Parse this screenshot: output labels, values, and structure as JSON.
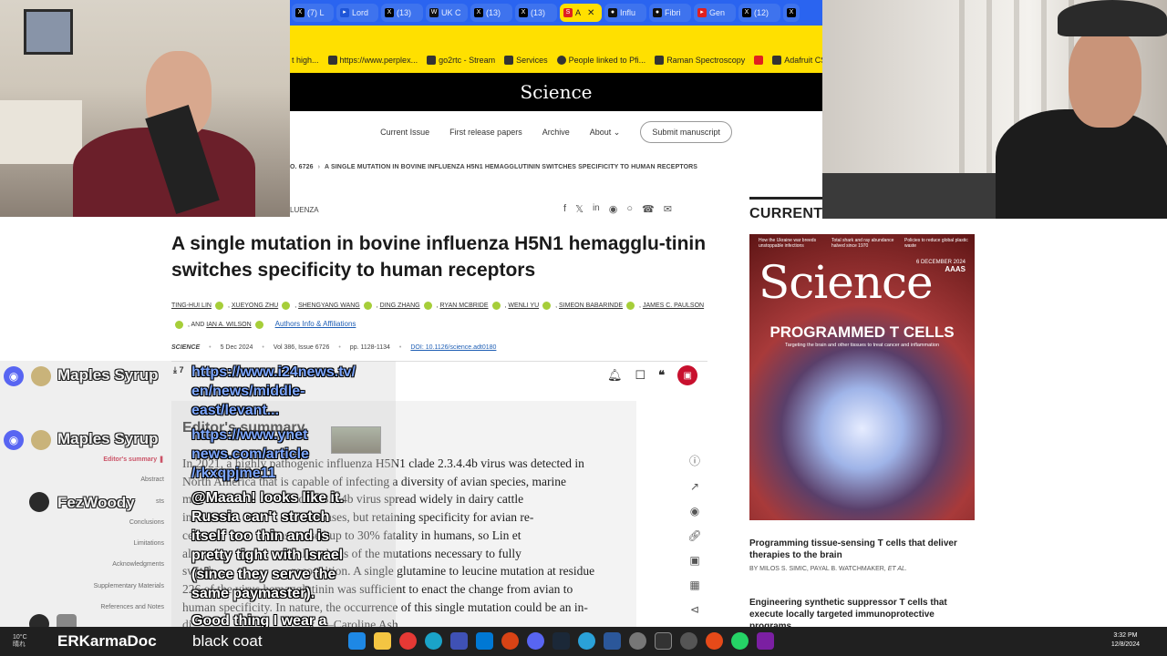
{
  "browser": {
    "tabs": [
      {
        "label": "(7) L"
      },
      {
        "label": "Lord"
      },
      {
        "label": "(13)"
      },
      {
        "label": "UK C"
      },
      {
        "label": "(13)"
      },
      {
        "label": "(13)"
      },
      {
        "label": "A",
        "active": true
      },
      {
        "label": "Influ"
      },
      {
        "label": "Fibri"
      },
      {
        "label": "Gen"
      },
      {
        "label": "(12)"
      },
      {
        "label": ""
      }
    ],
    "bookmarks": [
      {
        "label": "t high..."
      },
      {
        "label": "https://www.perplex..."
      },
      {
        "label": "go2rtc - Stream"
      },
      {
        "label": "Services"
      },
      {
        "label": "People linked to Pfi..."
      },
      {
        "label": "Raman Spectroscopy"
      },
      {
        "label": ""
      },
      {
        "label": "Adafruit CSI or DSI..."
      }
    ]
  },
  "site": {
    "logo": "Science",
    "nav": [
      "Current Issue",
      "First release papers",
      "Archive",
      "About"
    ],
    "submit": "Submit manuscript"
  },
  "breadcrumb": {
    "issue": "O. 6726",
    "article": "A SINGLE MUTATION IN BOVINE INFLUENZA H5N1 HEMAGGLUTININ SWITCHES SPECIFICITY TO HUMAN RECEPTORS"
  },
  "article": {
    "category": "LUENZA",
    "title": "A single mutation in bovine influenza H5N1 hemagglu-tinin switches specificity to human receptors",
    "authors": [
      "TING-HUI LIN",
      "XUEYONG ZHU",
      "SHENGYANG WANG",
      "DING ZHANG",
      "RYAN MCBRIDE",
      "WENLI YU",
      "SIMEON BABARINDE",
      "JAMES C. PAULSON"
    ],
    "and_label": ", AND",
    "last_author": "IAN A. WILSON",
    "affiliations_link": "Authors Info & Affiliations",
    "journal": "SCIENCE",
    "date": "5 Dec 2024",
    "volume": "Vol 386, Issue 6726",
    "pages": "pp. 1128-1134",
    "doi": "DOI: 10.1126/science.adt0180",
    "pdf_label": "PDF"
  },
  "toc": [
    "Editor's summary",
    "Abstract",
    "sts",
    "Conclusions",
    "Limitations",
    "Acknowledgments",
    "Supplementary Materials",
    "References and Notes"
  ],
  "summary": {
    "title": "Editor's summary",
    "lines": [
      "In 2021, a highly pathogenic influenza H5N1 clade 2.3.4.4b virus was detected in",
      "North America that is capable of infecting a diversity of avian species, marine",
      "m                              clade 2.3.4.4b virus spread widely in dairy cattle",
      "in                              human cases, but retaining specificity for avian re-",
      "ce                          has caused up to 30% fatality in humans, so Lin et",
      "al.                              ural analysis of the mutations necessary to fully",
      "switch                         recognition. A single glutamine to leucine mutation at residue",
      "226 of the virus hemagglutinin was sufficient to enact the change from avian to",
      "human specificity. In nature, the occurrence of this single mutation could be an in-",
      "di                                      k. —Caroline Ash"
    ]
  },
  "current_issue": {
    "heading": "CURRENT ISSUE",
    "cover": {
      "logo": "Science",
      "date": "6 DECEMBER 2024",
      "aaas": "AAAS",
      "headline": "PROGRAMMED T CELLS",
      "subhead": "Targeting the brain and other tissues to treat cancer and inflammation",
      "blurb1": "How the Ukraine war breeds unstoppable infections",
      "blurb2": "Total shark and ray abundance halved since 1970",
      "blurb3": "Policies to reduce global plastic waste"
    },
    "articles": [
      {
        "title": "Programming tissue-sensing T cells that deliver therapies to the brain",
        "authors": "BY MILOS S. SIMIC, PAYAL B. WATCHMAKER,",
        "etal": "ET AL."
      },
      {
        "title": "Engineering synthetic suppressor T cells that execute locally targeted immunoprotective programs",
        "authors": "",
        "etal": ""
      }
    ]
  },
  "chat": {
    "users": [
      "Maples Syrup",
      "Maples Syrup",
      "FezWoody",
      "ERKarmaDoc"
    ],
    "messages": [
      "https://www.i24news.tv/",
      "en/news/middle-",
      "east/levant...",
      "https://www.ynet",
      "news.com/article",
      "/rkxqpjme11",
      "@Maaah! looks like it.",
      "Russia can't stretch",
      "itself too thin and is",
      "pretty tight with Israel",
      "(since they serve the",
      "same paymaster).",
      "Good thing I wear a",
      "black coat"
    ],
    "count_prefix": "7"
  },
  "taskbar": {
    "weather": "10°C",
    "weather_desc": "晴れ",
    "time": "3:32 PM",
    "date": "12/8/2024"
  },
  "colors": {
    "tab_bar": "#2a64f0",
    "bookmark_bar": "#ffe000",
    "science_red": "#c8102e",
    "link_blue": "#1f5fb5",
    "orcid_green": "#a6ce39"
  }
}
